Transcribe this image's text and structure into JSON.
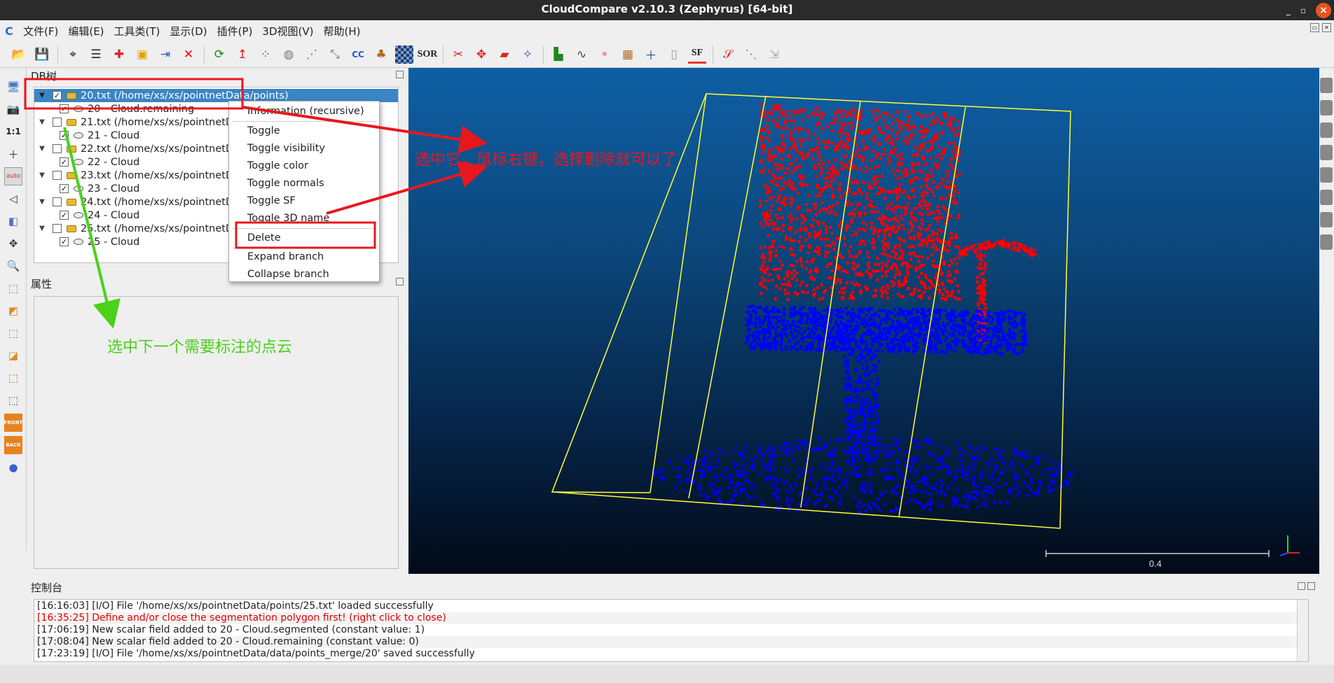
{
  "window": {
    "title": "CloudCompare v2.10.3 (Zephyrus) [64-bit]",
    "close": "×"
  },
  "menu": [
    "文件(F)",
    "编辑(E)",
    "工具类(T)",
    "显示(D)",
    "插件(P)",
    "3D视图(V)",
    "帮助(H)"
  ],
  "toolbar_icons": [
    "open-icon",
    "save-icon",
    "global-shift-icon",
    "list-icon",
    "translate-icon",
    "color-icon",
    "merge-icon",
    "delete-icon",
    "registration-icon",
    "normals-icon",
    "sample-icon",
    "octree-icon",
    "noise-icon",
    "project-icon",
    "compare-icon",
    "bucket-icon",
    "checker-icon",
    "sor-icon",
    "segment-icon",
    "rotate-icon",
    "plane-icon",
    "picking-icon",
    "histogram-icon",
    "curve-icon",
    "minmax-icon",
    "stats-icon",
    "add-icon",
    "trash-icon",
    "sf-icon",
    "sf-arrow-icon",
    "filter-icon",
    "export-icon"
  ],
  "toolbar_labels": {
    "sor": "SOR",
    "sf": "SF"
  },
  "db_tree": {
    "title": "DB树",
    "rows": [
      {
        "label": "20.txt (/home/xs/xs/pointnetData/points)",
        "type": "folder",
        "level": 0,
        "checked": true,
        "selected": true
      },
      {
        "label": "20 - Cloud.remaining",
        "type": "cloud",
        "level": 1,
        "checked": true
      },
      {
        "label": "21.txt (/home/xs/xs/pointnetData/points)",
        "type": "folder",
        "level": 0,
        "checked": false
      },
      {
        "label": "21 - Cloud",
        "type": "cloud",
        "level": 1,
        "checked": true
      },
      {
        "label": "22.txt (/home/xs/xs/pointnetData/points)",
        "type": "folder",
        "level": 0,
        "checked": false
      },
      {
        "label": "22 - Cloud",
        "type": "cloud",
        "level": 1,
        "checked": true
      },
      {
        "label": "23.txt (/home/xs/xs/pointnetData/points)",
        "type": "folder",
        "level": 0,
        "checked": false
      },
      {
        "label": "23 - Cloud",
        "type": "cloud",
        "level": 1,
        "checked": true
      },
      {
        "label": "24.txt (/home/xs/xs/pointnetData/points)",
        "type": "folder",
        "level": 0,
        "checked": false
      },
      {
        "label": "24 - Cloud",
        "type": "cloud",
        "level": 1,
        "checked": true
      },
      {
        "label": "25.txt (/home/xs/xs/pointnetData/points)",
        "type": "folder",
        "level": 0,
        "checked": false
      },
      {
        "label": "25 - Cloud",
        "type": "cloud",
        "level": 1,
        "checked": true
      }
    ]
  },
  "context_menu": [
    "Information (recursive)",
    "Toggle",
    "Toggle visibility",
    "Toggle color",
    "Toggle normals",
    "Toggle SF",
    "Toggle 3D name",
    "Delete",
    "Expand branch",
    "Collapse branch"
  ],
  "properties": {
    "title": "属性"
  },
  "view3d": {
    "scale_label": "0.4",
    "colors": {
      "top": "#0f5fa5",
      "bottom": "#020a17",
      "segmented": "#ff0000",
      "remaining": "#0000ff",
      "bbox": "#ffff33"
    }
  },
  "console": {
    "title": "控制台",
    "lines": [
      {
        "text": "[16:16:03] [I/O] File '/home/xs/xs/pointnetData/points/25.txt' loaded successfully",
        "error": false
      },
      {
        "text": "[16:35:25] Define and/or close the segmentation polygon first! (right click to close)",
        "error": true
      },
      {
        "text": "[17:06:19] New scalar field added to 20 - Cloud.segmented (constant value: 1)",
        "error": false
      },
      {
        "text": "[17:08:04] New scalar field added to 20 - Cloud.remaining (constant value: 0)",
        "error": false
      },
      {
        "text": "[17:23:19] [I/O] File '/home/xs/xs/pointnetData/data/points_merge/20' saved successfully",
        "error": false
      }
    ]
  },
  "annotations": {
    "red_note": "选中它，鼠标右键，选择删除就可以了",
    "green_note": "选中下一个需要标注的点云",
    "colors": {
      "red": "#e8171e",
      "green": "#4ad11a"
    }
  },
  "left_tool_labels": {
    "one_to_one": "1:1",
    "auto": "auto",
    "front": "FRONT",
    "back": "BACK"
  }
}
